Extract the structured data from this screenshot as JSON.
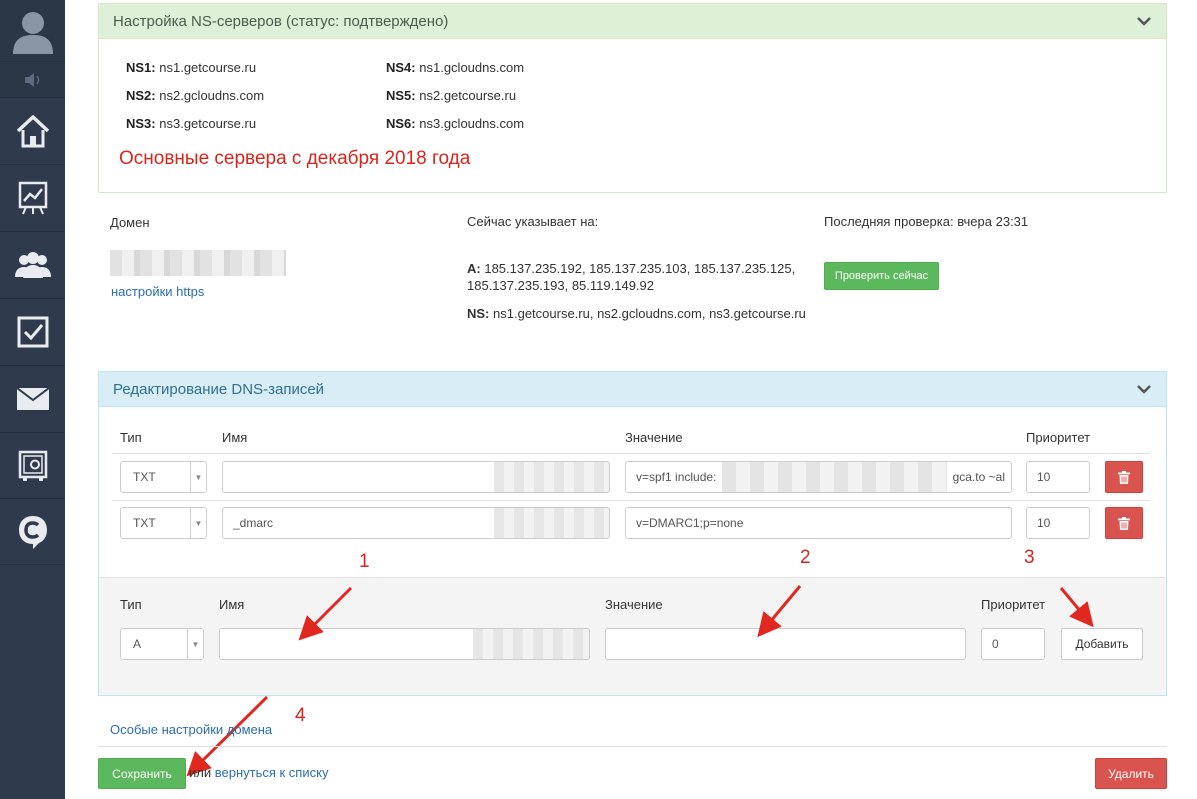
{
  "ns_panel": {
    "title": "Настройка NS-серверов (статус: подтверждено)",
    "servers": [
      {
        "label": "NS1:",
        "value": "ns1.getcourse.ru"
      },
      {
        "label": "NS2:",
        "value": "ns2.gcloudns.com"
      },
      {
        "label": "NS3:",
        "value": "ns3.getcourse.ru"
      },
      {
        "label": "NS4:",
        "value": "ns1.gcloudns.com"
      },
      {
        "label": "NS5:",
        "value": "ns2.getcourse.ru"
      },
      {
        "label": "NS6:",
        "value": "ns3.gcloudns.com"
      }
    ],
    "note": "Основные сервера с декабря 2018 года"
  },
  "domain_info": {
    "domain_label": "Домен",
    "https_link": "настройки https",
    "points_to_label": "Сейчас указывает на:",
    "a_label": "A:",
    "a_value_line1": "185.137.235.192, 185.137.235.103, 185.137.235.125,",
    "a_value_line2": "185.137.235.193, 85.119.149.92",
    "ns_label": "NS:",
    "ns_value": "ns1.getcourse.ru, ns2.gcloudns.com, ns3.getcourse.ru",
    "last_check": "Последняя проверка: вчера 23:31",
    "check_now_button": "Проверить сейчас"
  },
  "dns_panel": {
    "title": "Редактирование DNS-записей",
    "columns": {
      "type": "Тип",
      "name": "Имя",
      "value": "Значение",
      "priority": "Приоритет"
    },
    "records": [
      {
        "type": "TXT",
        "name": "",
        "value_start": "v=spf1 include:",
        "value_end": "gca.to ~al",
        "priority": "10"
      },
      {
        "type": "TXT",
        "name": "_dmarc",
        "value": "v=DMARC1;p=none",
        "priority": "10"
      }
    ],
    "new_record": {
      "columns": {
        "type": "Тип",
        "name": "Имя",
        "value": "Значение",
        "priority": "Приоритет"
      },
      "type": "A",
      "name": "",
      "value": "",
      "priority": "0",
      "add_button": "Добавить"
    }
  },
  "annotations": [
    "1",
    "2",
    "3",
    "4"
  ],
  "footer": {
    "special_settings_link": "Особые настройки домена",
    "save_button": "Сохранить",
    "or_text": "или",
    "back_link": "вернуться к списку",
    "delete_button": "Удалить"
  },
  "colors": {
    "sidebar": "#2f3b4c",
    "green_button": "#5cb85c",
    "red_button": "#d9534f",
    "annotation_red": "#d9251d",
    "link": "#2a6eb0"
  },
  "icons": [
    "user-avatar-icon",
    "speaker-icon",
    "home-icon",
    "chart-icon",
    "users-icon",
    "checkbox-icon",
    "mail-icon",
    "safe-icon",
    "getcourse-logo-icon",
    "chevron-down-icon",
    "trash-icon"
  ]
}
